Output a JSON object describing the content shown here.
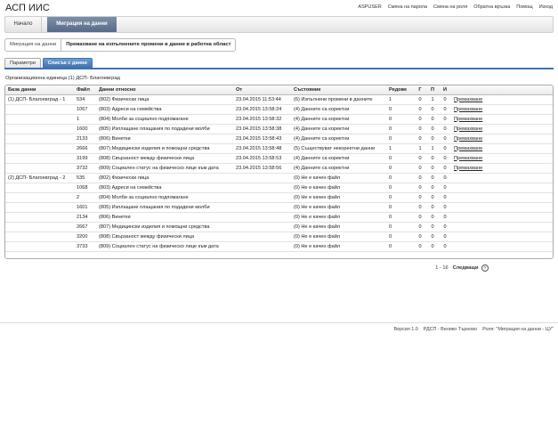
{
  "app": {
    "title": "АСП ИИС"
  },
  "top_links": [
    "ASPUSER",
    "Смяна на парола",
    "Смяна на роля",
    "Обратна връзка",
    "Помощ",
    "Изход"
  ],
  "nav": {
    "home": "Начало",
    "active": "Миграция на данни"
  },
  "breadcrumb": {
    "parent": "Миграция на данни",
    "current": "Премахване на изпълнените промени в данни в работна област"
  },
  "tabs": [
    "Параметри",
    "Списък с данни"
  ],
  "org_unit": {
    "label": "Организационна единица",
    "value": "(1) ДСП- Благоевград"
  },
  "table": {
    "headers": [
      "База данни",
      "Файл",
      "Данни относно",
      "От",
      "Състояние",
      "Редове",
      "Г",
      "П",
      "И",
      ""
    ],
    "rows": [
      [
        "(1) ДСП- Благоевград - 1",
        "534",
        "(802) Физически лица",
        "23.04.2015 11:53:44",
        "(6) Изпълнени промени в данните",
        "1",
        "0",
        "1",
        "0",
        "Премахване"
      ],
      [
        "",
        "1067",
        "(803) Адреси на семейства",
        "23.04.2015 13:58:24",
        "(4) Данните са коректни",
        "0",
        "0",
        "0",
        "0",
        "Премахване"
      ],
      [
        "",
        "1",
        "(804) Молби за социално подпомагане",
        "23.04.2015 13:58:32",
        "(4) Данните са коректни",
        "0",
        "0",
        "0",
        "0",
        "Премахване"
      ],
      [
        "",
        "1600",
        "(805) Изплащане плащания по подадени молби",
        "23.04.2015 13:58:38",
        "(4) Данните са коректни",
        "0",
        "0",
        "0",
        "0",
        "Премахване"
      ],
      [
        "",
        "2133",
        "(806) Винетки",
        "23.04.2015 13:58:43",
        "(4) Данните са коректни",
        "0",
        "0",
        "0",
        "0",
        "Премахване"
      ],
      [
        "",
        "2666",
        "(807) Медицински изделия и помощни средства",
        "23.04.2015 13:58:48",
        "(5) Съществуват некоректни данни",
        "1",
        "1",
        "1",
        "0",
        "Премахване"
      ],
      [
        "",
        "3199",
        "(808) Свързаност между физически лица",
        "23.04.2015 13:58:53",
        "(4) Данните са коректни",
        "0",
        "0",
        "0",
        "0",
        "Премахване"
      ],
      [
        "",
        "3732",
        "(809) Социален статус на физическо лице към дата",
        "23.04.2015 13:58:56",
        "(4) Данните са коректни",
        "0",
        "0",
        "0",
        "0",
        "Премахване"
      ],
      [
        "(2) ДСП- Благоевград - 2",
        "535",
        "(802) Физически лица",
        "",
        "(0) Не е качен файл",
        "0",
        "0",
        "0",
        "0",
        ""
      ],
      [
        "",
        "1068",
        "(803) Адреси на семейства",
        "",
        "(0) Не е качен файл",
        "0",
        "0",
        "0",
        "0",
        ""
      ],
      [
        "",
        "2",
        "(804) Молби за социално подпомагане",
        "",
        "(0) Не е качен файл",
        "0",
        "0",
        "0",
        "0",
        ""
      ],
      [
        "",
        "1601",
        "(805) Изплащане плащания по подадени молби",
        "",
        "(0) Не е качен файл",
        "0",
        "0",
        "0",
        "0",
        ""
      ],
      [
        "",
        "2134",
        "(806) Винетки",
        "",
        "(0) Не е качен файл",
        "0",
        "0",
        "0",
        "0",
        ""
      ],
      [
        "",
        "2667",
        "(807) Медицински изделия и помощни средства",
        "",
        "(0) Не е качен файл",
        "0",
        "0",
        "0",
        "0",
        ""
      ],
      [
        "",
        "3200",
        "(808) Свързаност между физически лица",
        "",
        "(0) Не е качен файл",
        "0",
        "0",
        "0",
        "0",
        ""
      ],
      [
        "",
        "3733",
        "(809) Социален статус на физическо лице към дата",
        "",
        "(0) Не е качен файл",
        "0",
        "0",
        "0",
        "0",
        ""
      ]
    ]
  },
  "pager": {
    "range": "1 - 16",
    "next": "Следващи"
  },
  "footer": {
    "version": "Версия 1.0",
    "org": "РДСП - Велико Търново",
    "role": "Роля: \"Миграция на данни - ЦУ\""
  }
}
